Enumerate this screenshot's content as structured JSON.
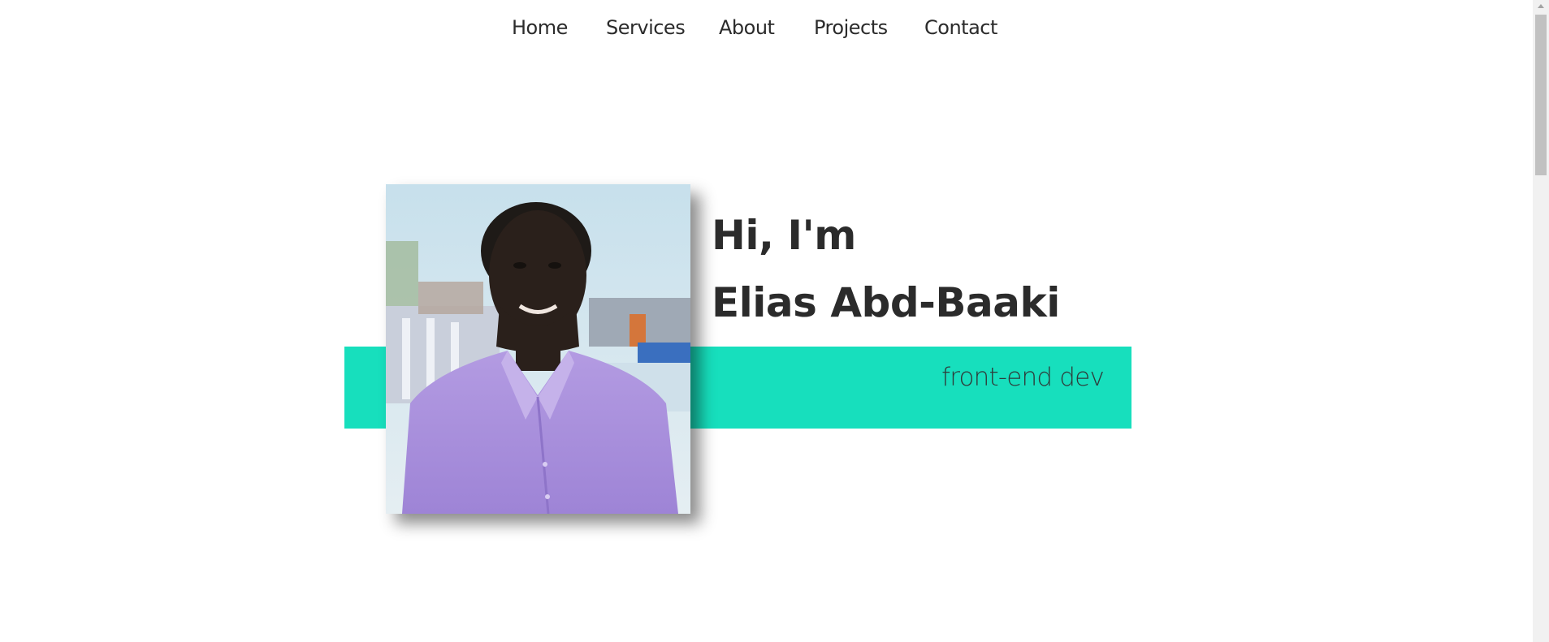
{
  "nav": {
    "items": [
      {
        "label": "Home"
      },
      {
        "label": "Services"
      },
      {
        "label": "About"
      },
      {
        "label": "Projects"
      },
      {
        "label": "Contact"
      }
    ]
  },
  "hero": {
    "greeting": "Hi, I'm",
    "name": "Elias Abd-Baaki",
    "role": "front-end dev",
    "accent_color": "#17dfbd",
    "photo_description_icon": "profile-photo"
  },
  "scrollbar": {
    "up_icon": "triangle-up-icon"
  }
}
